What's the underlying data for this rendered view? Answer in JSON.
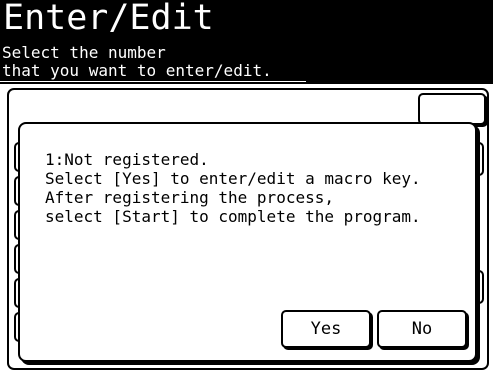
{
  "header": {
    "title": "Enter/Edit",
    "subtitle_line1": "Select the number",
    "subtitle_line2": "that you want to enter/edit."
  },
  "dialog": {
    "line1": "1:Not registered.",
    "line2": "Select [Yes] to enter/edit a macro key.",
    "line3": "After registering the process,",
    "line4": "select [Start] to complete the program.",
    "yes_label": "Yes",
    "no_label": "No"
  },
  "colors": {
    "header_bg": "#000000",
    "header_text": "#ffffff",
    "text": "#000000",
    "background": "#ffffff"
  }
}
